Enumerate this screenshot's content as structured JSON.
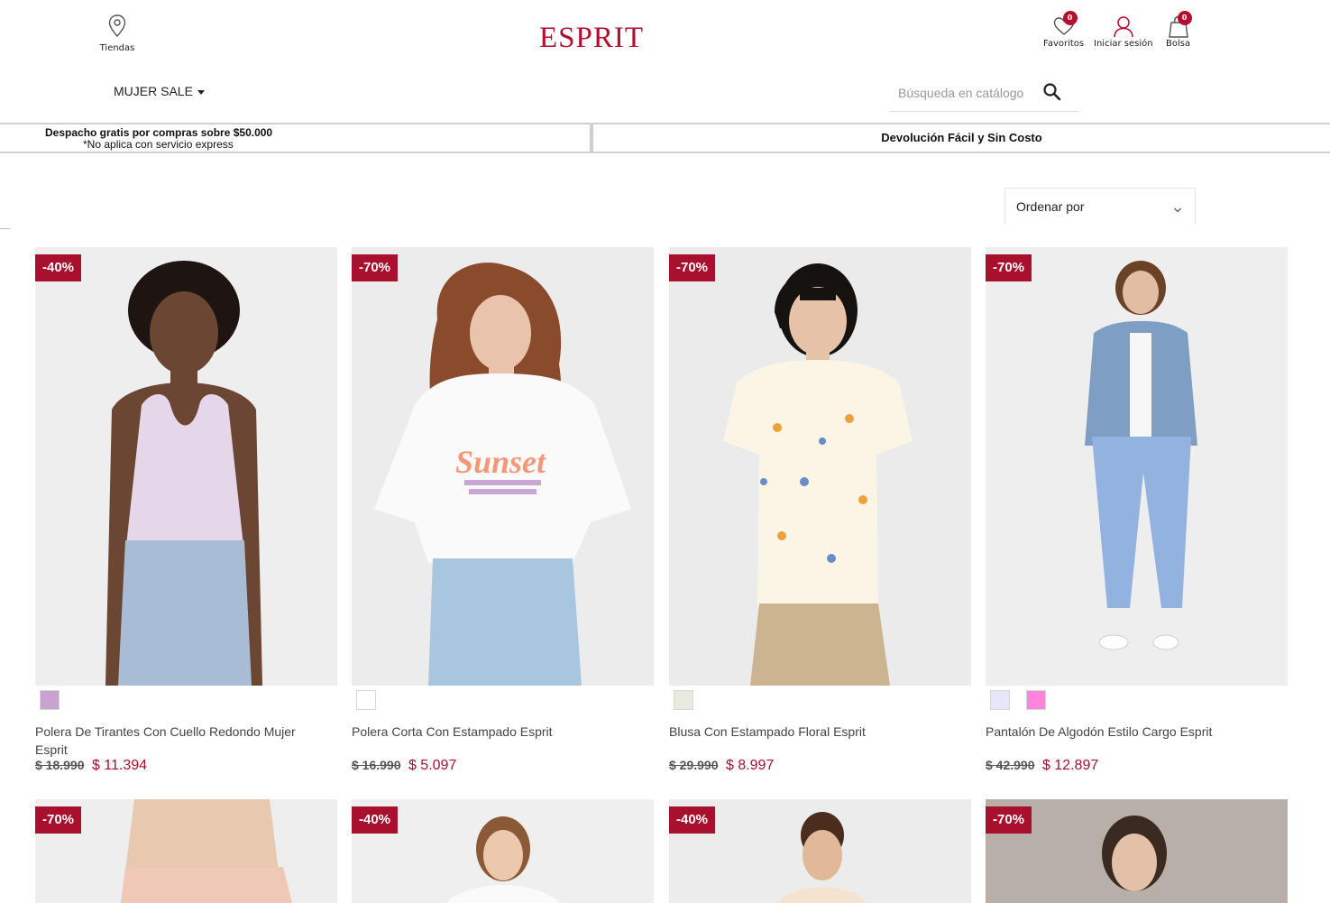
{
  "header": {
    "stores_label": "Tiendas",
    "logo_text": "ESPRIT",
    "favorites": {
      "label": "Favoritos",
      "count": "0"
    },
    "login": {
      "label": "Iniciar sesión"
    },
    "bag": {
      "label": "Bolsa",
      "count": "0"
    },
    "nav_menu_label": "MUJER SALE",
    "search_placeholder": "Búsqueda en catálogo"
  },
  "promo": {
    "left_main": "Despacho gratis por compras sobre $50.000",
    "left_sub": "*No aplica con servicio express",
    "right": "Devolución Fácil y Sin Costo"
  },
  "sort": {
    "label": "Ordenar por"
  },
  "colors": {
    "accent": "#a8102e",
    "logo": "#b50d2e"
  },
  "products": [
    {
      "discount": "-40%",
      "name": "Polera De Tirantes Con Cuello Redondo Mujer Esprit",
      "old_price": "$ 18.990",
      "price": "$ 11.394",
      "swatches": [
        "#c9a3cf"
      ]
    },
    {
      "discount": "-70%",
      "name": "Polera Corta Con Estampado Esprit",
      "old_price": "$ 16.990",
      "price": "$ 5.097",
      "swatches": [
        "#ffffff"
      ]
    },
    {
      "discount": "-70%",
      "name": "Blusa Con Estampado Floral Esprit",
      "old_price": "$ 29.990",
      "price": "$ 8.997",
      "swatches": [
        "#e8ecdf"
      ]
    },
    {
      "discount": "-70%",
      "name": "Pantalón De Algodón Estilo Cargo Esprit",
      "old_price": "$ 42.990",
      "price": "$ 12.897",
      "swatches": [
        "#e6e6fb",
        "#ff85d8"
      ]
    },
    {
      "discount": "-70%"
    },
    {
      "discount": "-40%"
    },
    {
      "discount": "-40%"
    },
    {
      "discount": "-70%"
    }
  ]
}
